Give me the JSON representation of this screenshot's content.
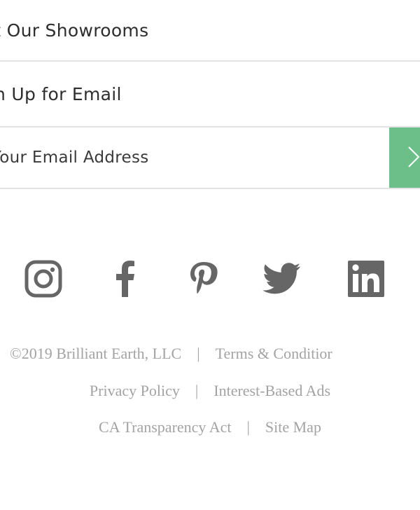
{
  "rows": {
    "showrooms_label": "it Our Showrooms",
    "signup_label": "n Up for Email"
  },
  "email": {
    "placeholder": "Your Email Address",
    "submit_color": "#6dbf8a"
  },
  "social": {
    "icons": [
      "instagram-icon",
      "facebook-icon",
      "pinterest-icon",
      "twitter-icon",
      "linkedin-icon"
    ],
    "icon_color": "#666666"
  },
  "footer": {
    "copyright": "©2019 Brilliant Earth, LLC",
    "separator": "|",
    "terms": "Terms & Conditior",
    "privacy": "Privacy Policy",
    "interest_ads": "Interest-Based Ads",
    "ca_transparency": "CA Transparency Act",
    "site_map": "Site Map"
  }
}
